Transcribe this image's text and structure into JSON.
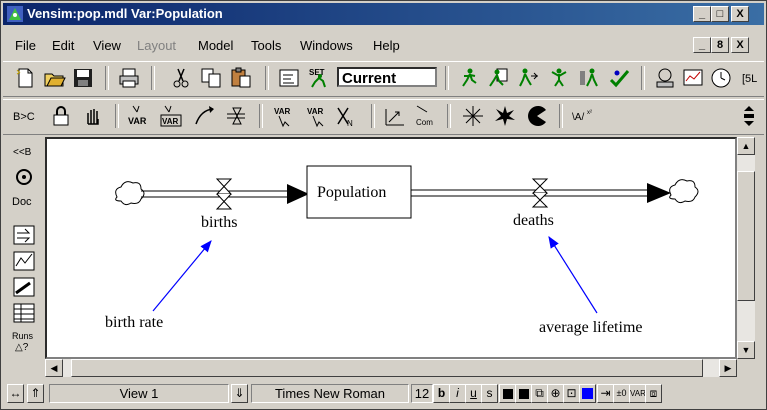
{
  "window": {
    "title": "Vensim:pop.mdl Var:Population",
    "caption_buttons": [
      "_",
      "□",
      "X"
    ]
  },
  "menu": {
    "items": [
      {
        "label": "File",
        "enabled": true
      },
      {
        "label": "Edit",
        "enabled": true
      },
      {
        "label": "View",
        "enabled": true
      },
      {
        "label": "Layout",
        "enabled": false
      },
      {
        "label": "Model",
        "enabled": true
      },
      {
        "label": "Tools",
        "enabled": true
      },
      {
        "label": "Windows",
        "enabled": true
      },
      {
        "label": "Help",
        "enabled": true
      }
    ],
    "mdi_buttons": [
      "_",
      "8",
      "X"
    ]
  },
  "toolbar": {
    "set_label": "SET",
    "run_name": "Current"
  },
  "sketch_tools": {
    "var_label": "VAR",
    "com_label": "Com",
    "x2_label": "x²"
  },
  "left_tools": {
    "doc_label": "Doc",
    "runs_label": "Runs"
  },
  "diagram": {
    "stock": "Population",
    "inflow": "births",
    "outflow": "deaths",
    "aux1": "birth rate",
    "aux2": "average lifetime"
  },
  "status": {
    "view": "View 1",
    "font": "Times New Roman",
    "size": "12",
    "bold": "b",
    "italic": "i",
    "underline": "u",
    "strike": "s"
  },
  "colors": {
    "title_bar": "#0a246a",
    "arrow": "#0000ff",
    "accent_square": "#0000ff"
  }
}
